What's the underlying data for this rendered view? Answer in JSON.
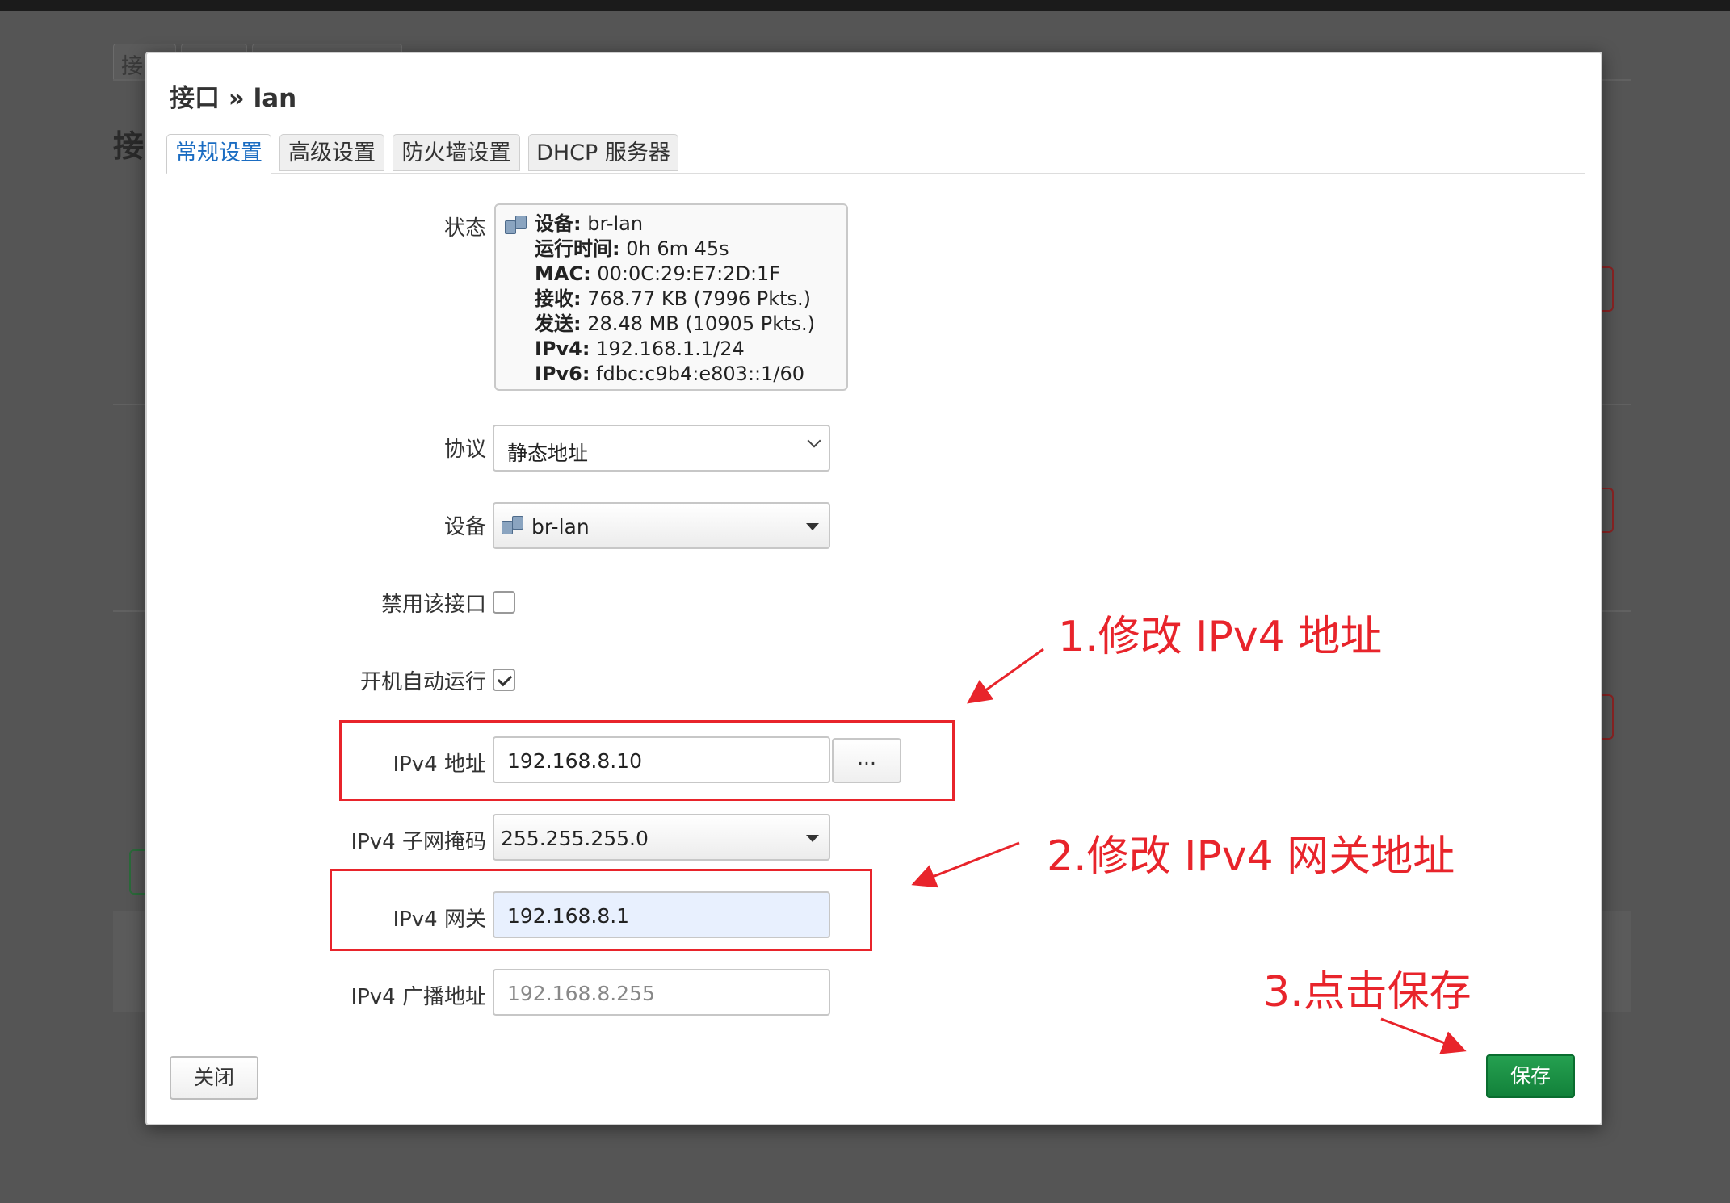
{
  "background": {
    "tab_label": "接",
    "heading": "接"
  },
  "modal": {
    "title": "接口 » lan",
    "tabs": [
      {
        "label": "常规设置",
        "active": true
      },
      {
        "label": "高级设置",
        "active": false
      },
      {
        "label": "防火墙设置",
        "active": false
      },
      {
        "label": "DHCP 服务器",
        "active": false
      }
    ],
    "status": {
      "label": "状态",
      "device_key": "设备:",
      "device_val": "br-lan",
      "uptime_key": "运行时间:",
      "uptime_val": "0h 6m 45s",
      "mac_key": "MAC:",
      "mac_val": "00:0C:29:E7:2D:1F",
      "rx_key": "接收:",
      "rx_val": "768.77 KB (7996 Pkts.)",
      "tx_key": "发送:",
      "tx_val": "28.48 MB (10905 Pkts.)",
      "ipv4_key": "IPv4:",
      "ipv4_val": "192.168.1.1/24",
      "ipv6_key": "IPv6:",
      "ipv6_val": "fdbc:c9b4:e803::1/60"
    },
    "protocol": {
      "label": "协议",
      "value": "静态地址"
    },
    "device": {
      "label": "设备",
      "value": "br-lan"
    },
    "disable_iface": {
      "label": "禁用该接口",
      "checked": false
    },
    "autostart": {
      "label": "开机自动运行",
      "checked": true
    },
    "ipv4_addr": {
      "label": "IPv4 地址",
      "value": "192.168.8.10",
      "more_button": "..."
    },
    "ipv4_netmask": {
      "label": "IPv4 子网掩码",
      "value": "255.255.255.0"
    },
    "ipv4_gateway": {
      "label": "IPv4 网关",
      "value": "192.168.8.1"
    },
    "ipv4_broadcast": {
      "label": "IPv4 广播地址",
      "placeholder": "192.168.8.255"
    },
    "close_button": "关闭",
    "save_button": "保存"
  },
  "annotations": {
    "step1": "1.修改 IPv4 地址",
    "step2": "2.修改 IPv4 网关地址",
    "step3": "3.点击保存",
    "color": "#e8242b"
  },
  "colors": {
    "active_tab": "#1a6cc2",
    "save_button": "#12813a",
    "overlay": "#555555"
  }
}
